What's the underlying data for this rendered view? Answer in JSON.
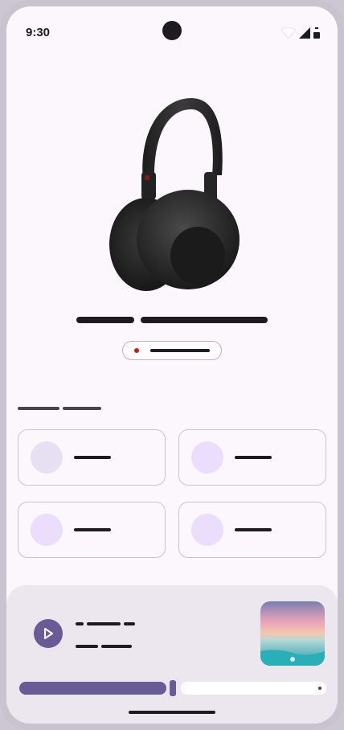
{
  "status_bar": {
    "time": "9:30",
    "icons": [
      "wifi-icon",
      "signal-icon",
      "battery-icon"
    ]
  },
  "product": {
    "image": "headphones-image",
    "title_placeholders": 2,
    "status_chip_color": "#b3261e"
  },
  "section": {
    "header_placeholders": 2
  },
  "cards": [
    {
      "circle_color": "#e7e0f3"
    },
    {
      "circle_color": "#ebddfc"
    },
    {
      "circle_color": "#ebddfc"
    },
    {
      "circle_color": "#ebddfc"
    }
  ],
  "player": {
    "play_button_color": "#6a5a95",
    "progress_fraction": 0.49,
    "album_art": "seascape-sunset-image"
  },
  "colors": {
    "background": "#fcf7fd",
    "accent": "#6a5a95",
    "player_surface": "#ece6ef"
  }
}
